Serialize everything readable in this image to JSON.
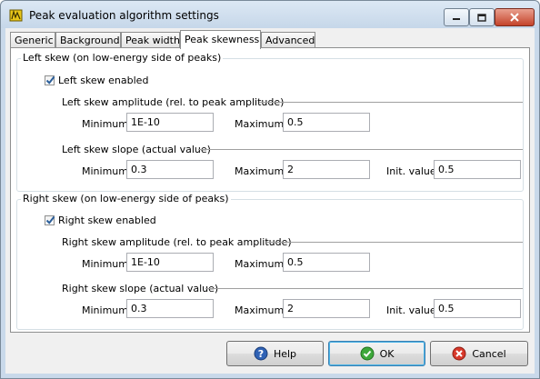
{
  "window": {
    "title": "Peak evaluation algorithm settings"
  },
  "tabs": [
    {
      "label": "Generic"
    },
    {
      "label": "Background"
    },
    {
      "label": "Peak width"
    },
    {
      "label": "Peak skewness"
    },
    {
      "label": "Advanced"
    }
  ],
  "active_tab": "Peak skewness",
  "left": {
    "group_title": "Left skew  (on low-energy side of peaks)",
    "enabled_label": "Left skew enabled",
    "enabled": true,
    "amplitude": {
      "title": "Left skew amplitude (rel. to peak amplitude)",
      "min_label": "Minimum:",
      "min_value": "1E-10",
      "max_label": "Maximum:",
      "max_value": "0.5"
    },
    "slope": {
      "title": "Left skew slope (actual value)",
      "min_label": "Minimum:",
      "min_value": "0.3",
      "max_label": "Maximum:",
      "max_value": "2",
      "init_label": "Init. value:",
      "init_value": "0.5"
    }
  },
  "right": {
    "group_title": "Right skew  (on low-energy side of peaks)",
    "enabled_label": "Right skew enabled",
    "enabled": true,
    "amplitude": {
      "title": "Right skew amplitude (rel. to peak amplitude)",
      "min_label": "Minimum:",
      "min_value": "1E-10",
      "max_label": "Maximum:",
      "max_value": "0.5"
    },
    "slope": {
      "title": "Right skew slope (actual value)",
      "min_label": "Minimum:",
      "min_value": "0.3",
      "max_label": "Maximum:",
      "max_value": "2",
      "init_label": "Init. value:",
      "init_value": "0.5"
    }
  },
  "buttons": {
    "help": {
      "label": "Help",
      "icon": "help-icon"
    },
    "ok": {
      "label": "OK",
      "icon": "check-icon"
    },
    "cancel": {
      "label": "Cancel",
      "icon": "cancel-icon"
    }
  }
}
